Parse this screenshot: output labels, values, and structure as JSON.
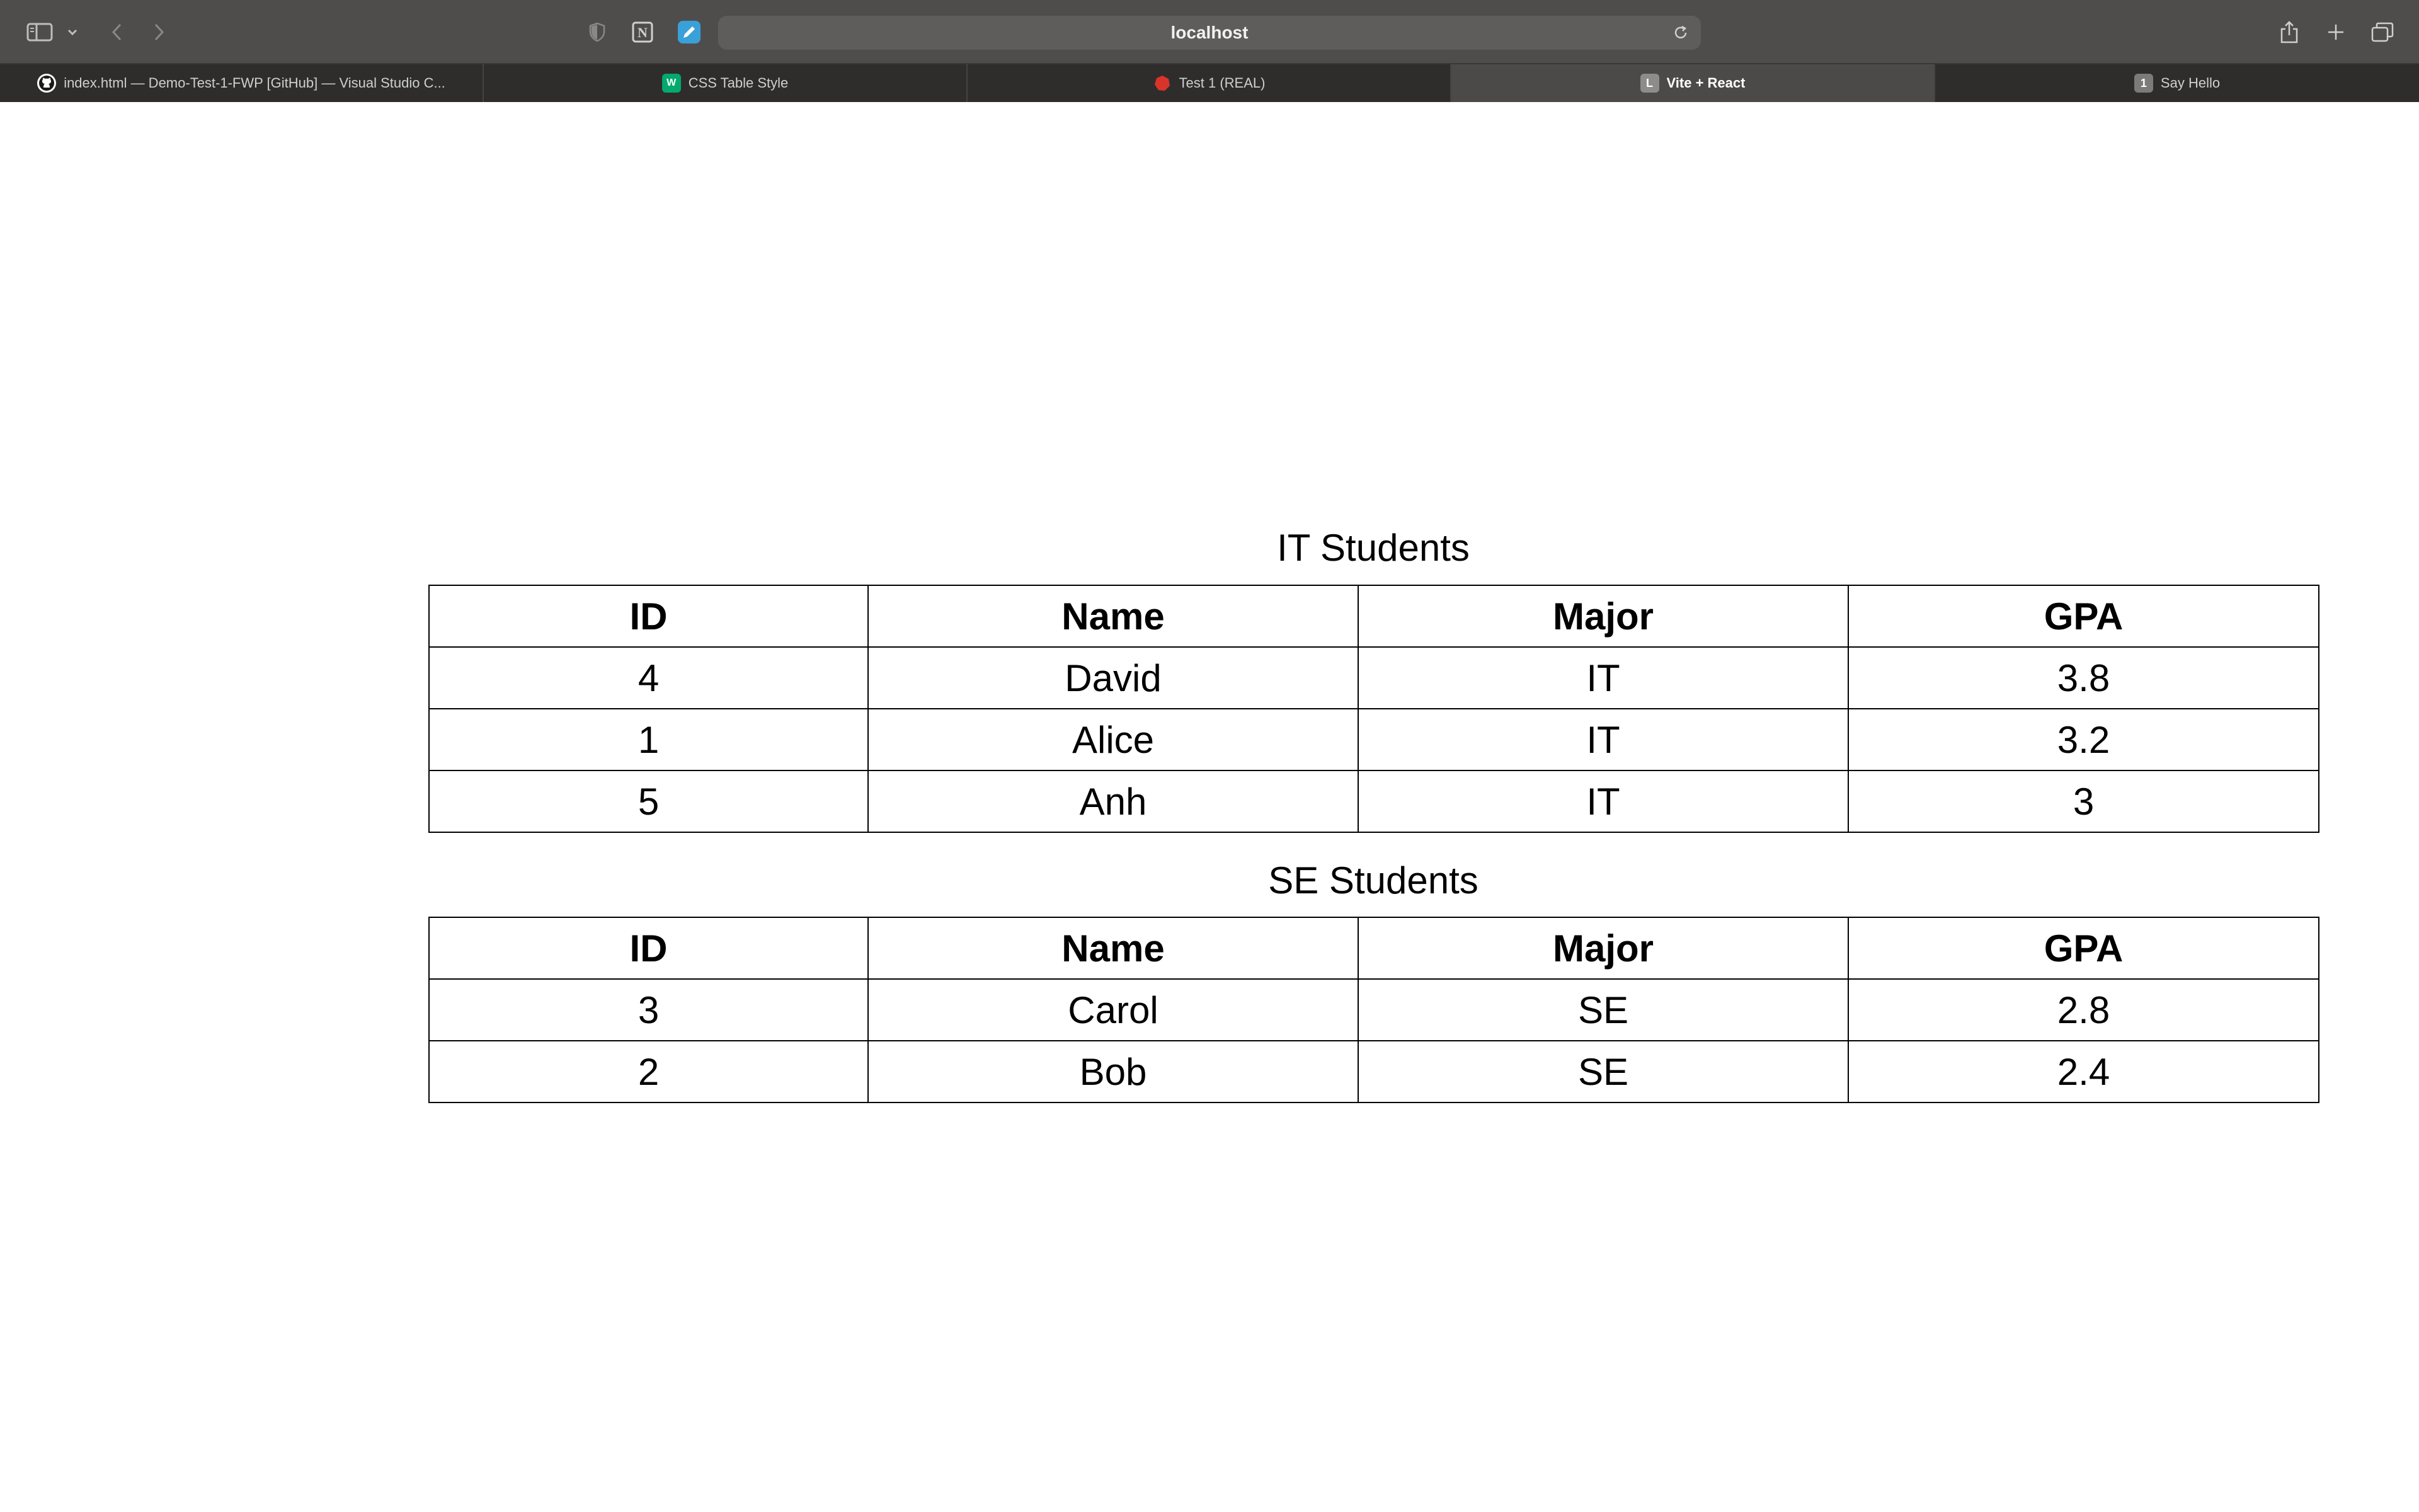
{
  "browser": {
    "url": "localhost",
    "icons": {
      "sidebar": "sidebar-icon",
      "sidebar_menu": "chevron-down-icon",
      "back": "back-arrow-icon",
      "forward": "forward-arrow-icon",
      "privacy": "shield-icon",
      "notion": "notion-icon",
      "extension": "pen-extension-icon",
      "reload": "reload-icon",
      "share": "share-icon",
      "new_tab": "plus-icon",
      "tab_overview": "tab-overview-icon"
    },
    "tabs": [
      {
        "label": "index.html — Demo-Test-1-FWP [GitHub] — Visual Studio C...",
        "favicon": "github-icon",
        "active": false
      },
      {
        "label": "CSS Table Style",
        "favicon": "w3schools-icon",
        "active": false
      },
      {
        "label": "Test 1 (REAL)",
        "favicon": "red-app-icon",
        "active": false
      },
      {
        "label": "Vite + React",
        "favicon": "letter-l-icon",
        "favicon_text": "L",
        "active": true
      },
      {
        "label": "Say Hello",
        "favicon": "letter-1-icon",
        "favicon_text": "1",
        "active": false
      }
    ]
  },
  "page": {
    "tables": [
      {
        "caption": "IT Students",
        "headers": [
          "ID",
          "Name",
          "Major",
          "GPA"
        ],
        "rows": [
          [
            "4",
            "David",
            "IT",
            "3.8"
          ],
          [
            "1",
            "Alice",
            "IT",
            "3.2"
          ],
          [
            "5",
            "Anh",
            "IT",
            "3"
          ]
        ]
      },
      {
        "caption": "SE Students",
        "headers": [
          "ID",
          "Name",
          "Major",
          "GPA"
        ],
        "rows": [
          [
            "3",
            "Carol",
            "SE",
            "2.8"
          ],
          [
            "2",
            "Bob",
            "SE",
            "2.4"
          ]
        ]
      }
    ]
  },
  "colors": {
    "toolbar_bg": "#4f4d4c",
    "tabbar_bg": "#2e2d2c",
    "active_tab_bg": "#4b4a49",
    "page_bg": "#ffffff",
    "table_border": "#000000"
  }
}
